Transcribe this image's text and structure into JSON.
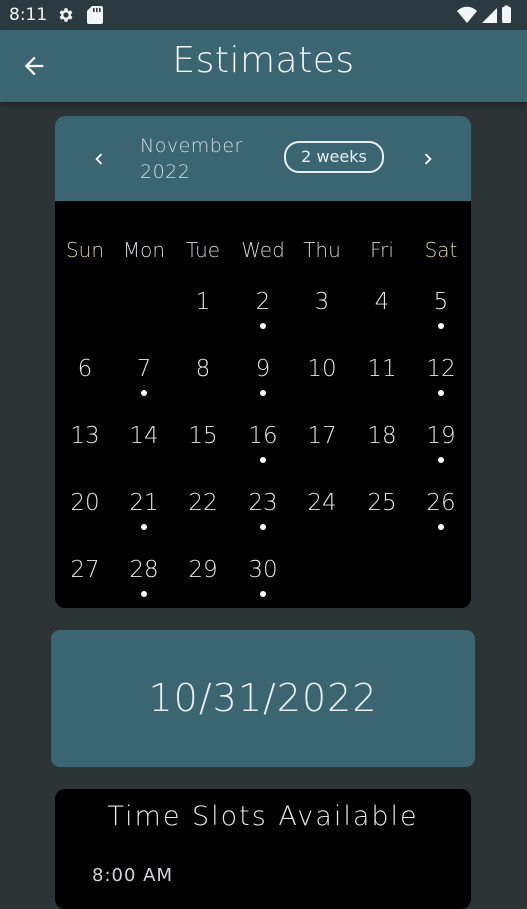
{
  "status_bar": {
    "time": "8:11"
  },
  "app_bar": {
    "title": "Estimates"
  },
  "calendar": {
    "month_label": "November",
    "year_label": "2022",
    "view_toggle": "2 weeks",
    "weekdays": [
      "Sun",
      "Mon",
      "Tue",
      "Wed",
      "Thu",
      "Fri",
      "Sat"
    ],
    "weeks": [
      [
        {
          "day": "",
          "dot": false
        },
        {
          "day": "",
          "dot": false
        },
        {
          "day": "1",
          "dot": false
        },
        {
          "day": "2",
          "dot": true
        },
        {
          "day": "3",
          "dot": false
        },
        {
          "day": "4",
          "dot": false
        },
        {
          "day": "5",
          "dot": true
        }
      ],
      [
        {
          "day": "6",
          "dot": false
        },
        {
          "day": "7",
          "dot": true
        },
        {
          "day": "8",
          "dot": false
        },
        {
          "day": "9",
          "dot": true
        },
        {
          "day": "10",
          "dot": false
        },
        {
          "day": "11",
          "dot": false
        },
        {
          "day": "12",
          "dot": true
        }
      ],
      [
        {
          "day": "13",
          "dot": false
        },
        {
          "day": "14",
          "dot": false
        },
        {
          "day": "15",
          "dot": false
        },
        {
          "day": "16",
          "dot": true
        },
        {
          "day": "17",
          "dot": false
        },
        {
          "day": "18",
          "dot": false
        },
        {
          "day": "19",
          "dot": true
        }
      ],
      [
        {
          "day": "20",
          "dot": false
        },
        {
          "day": "21",
          "dot": true
        },
        {
          "day": "22",
          "dot": false
        },
        {
          "day": "23",
          "dot": true
        },
        {
          "day": "24",
          "dot": false
        },
        {
          "day": "25",
          "dot": false
        },
        {
          "day": "26",
          "dot": true
        }
      ],
      [
        {
          "day": "27",
          "dot": false
        },
        {
          "day": "28",
          "dot": true
        },
        {
          "day": "29",
          "dot": false
        },
        {
          "day": "30",
          "dot": true
        },
        {
          "day": "",
          "dot": false
        },
        {
          "day": "",
          "dot": false
        },
        {
          "day": "",
          "dot": false
        }
      ]
    ]
  },
  "selected_date": "10/31/2022",
  "slots": {
    "title": "Time Slots Available",
    "items": [
      "8:00 AM"
    ]
  },
  "icons": {
    "back": "arrow-left-icon",
    "prev": "chevron-left-icon",
    "next": "chevron-right-icon",
    "settings": "gear-icon",
    "sd": "sd-card-icon",
    "wifi": "wifi-icon",
    "signal": "signal-icon",
    "battery": "battery-icon"
  },
  "colors": {
    "app_bar": "#3b6570",
    "background": "#2c3436",
    "weekend_label": "#d7d29c"
  }
}
